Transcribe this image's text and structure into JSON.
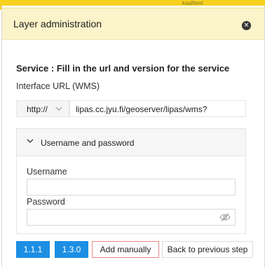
{
  "background": {
    "crumb_text": "kaallteet"
  },
  "dialog": {
    "title": "Layer administration",
    "close_icon": "close-icon",
    "heading": "Service : Fill in the url and version for the service",
    "interface_label": "Interface URL (WMS)",
    "protocol_value": "http://",
    "url_value": "lipas.cc.jyu.fi/geoserver/lipas/wms?",
    "credentials": {
      "header": "Username and password",
      "expanded": true,
      "username_label": "Username",
      "username_value": "",
      "password_label": "Password",
      "password_value": ""
    },
    "buttons": {
      "version_1": "1.1.1",
      "version_2": "1.3.0",
      "add_manually": "Add manually",
      "back": "Back to previous step"
    }
  },
  "colors": {
    "accent_yellow": "#f7d11e",
    "title_bg": "#fbf3c9",
    "primary_blue": "#1d8fe3",
    "danger_border": "#e88888"
  }
}
